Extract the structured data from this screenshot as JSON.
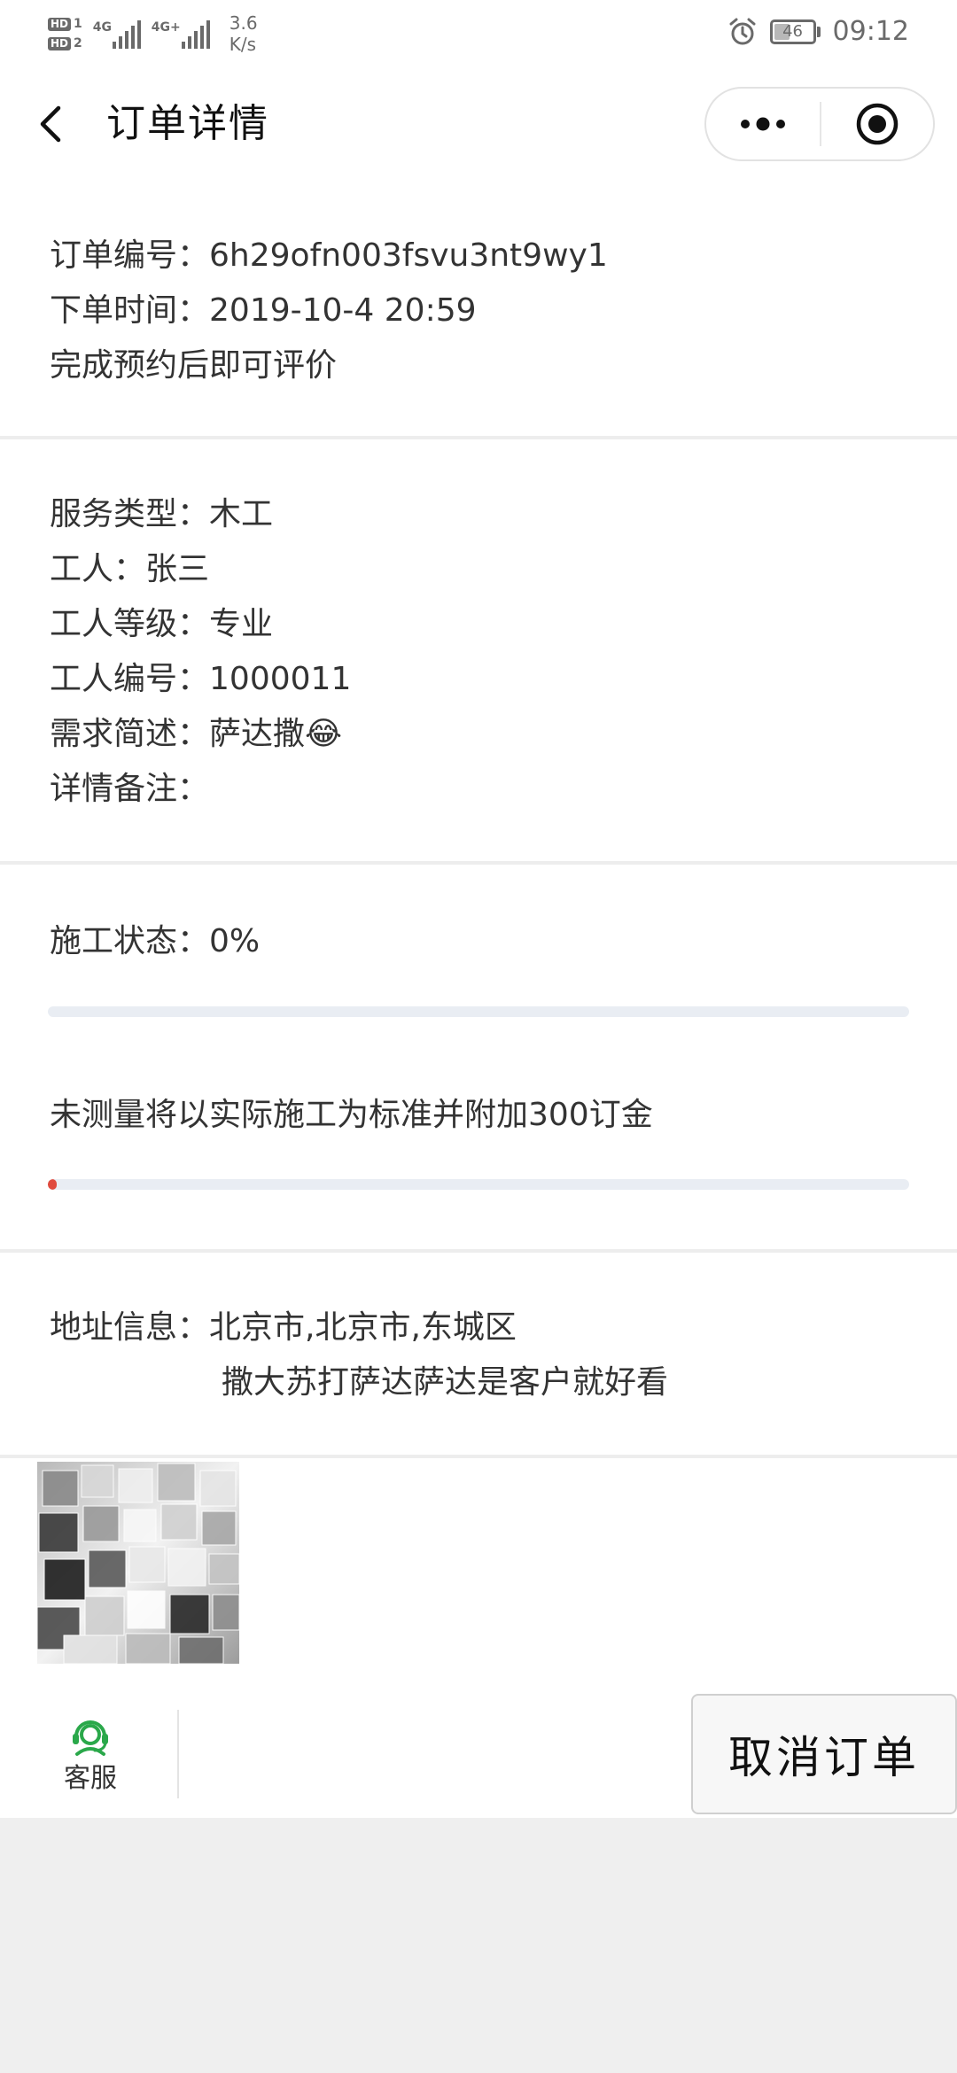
{
  "status_bar": {
    "hd1": "HD",
    "hd1_slot": "1",
    "hd2": "HD",
    "hd2_slot": "2",
    "network1": "4G",
    "network2": "4G+",
    "speed_value": "3.6",
    "speed_unit": "K/s",
    "battery_level": "46",
    "battery_percent": 46,
    "time": "09:12",
    "icons": [
      "signal-icon",
      "alarm-icon",
      "battery-icon"
    ]
  },
  "nav": {
    "title": "订单详情",
    "icons": [
      "back-arrow-icon",
      "more-dots-icon",
      "close-target-icon"
    ]
  },
  "order": {
    "number_label": "订单编号：",
    "number_value": "6h29ofn003fsvu3nt9wy1",
    "time_label": "下单时间：",
    "time_value": "2019-10-4 20:59",
    "review_hint": "完成预约后即可评价"
  },
  "service": {
    "type_label": "服务类型：",
    "type_value": "木工",
    "worker_label": "工人：",
    "worker_value": "张三",
    "level_label": "工人等级：",
    "level_value": "专业",
    "worker_no_label": "工人编号：",
    "worker_no_value": "1000011",
    "demand_label": "需求简述：",
    "demand_value": "萨达撒😂",
    "remark_label": "详情备注：",
    "remark_value": ""
  },
  "construction": {
    "status_label": "施工状态：",
    "status_value": "0%",
    "status_progress": 0,
    "measure_note": "未测量将以实际施工为标准并附加300订金",
    "measure_progress": 0.01
  },
  "address": {
    "label": "地址信息：",
    "line1": "北京市,北京市,东城区",
    "line2": "撒大苏打萨达萨达是客户就好看"
  },
  "bottom": {
    "service_label": "客服",
    "cancel_label": "取消订单",
    "icons": [
      "customer-service-icon"
    ]
  },
  "colors": {
    "accent_green": "#2aa84a",
    "progress_red": "#e04b3e",
    "track": "#e9edf3"
  }
}
